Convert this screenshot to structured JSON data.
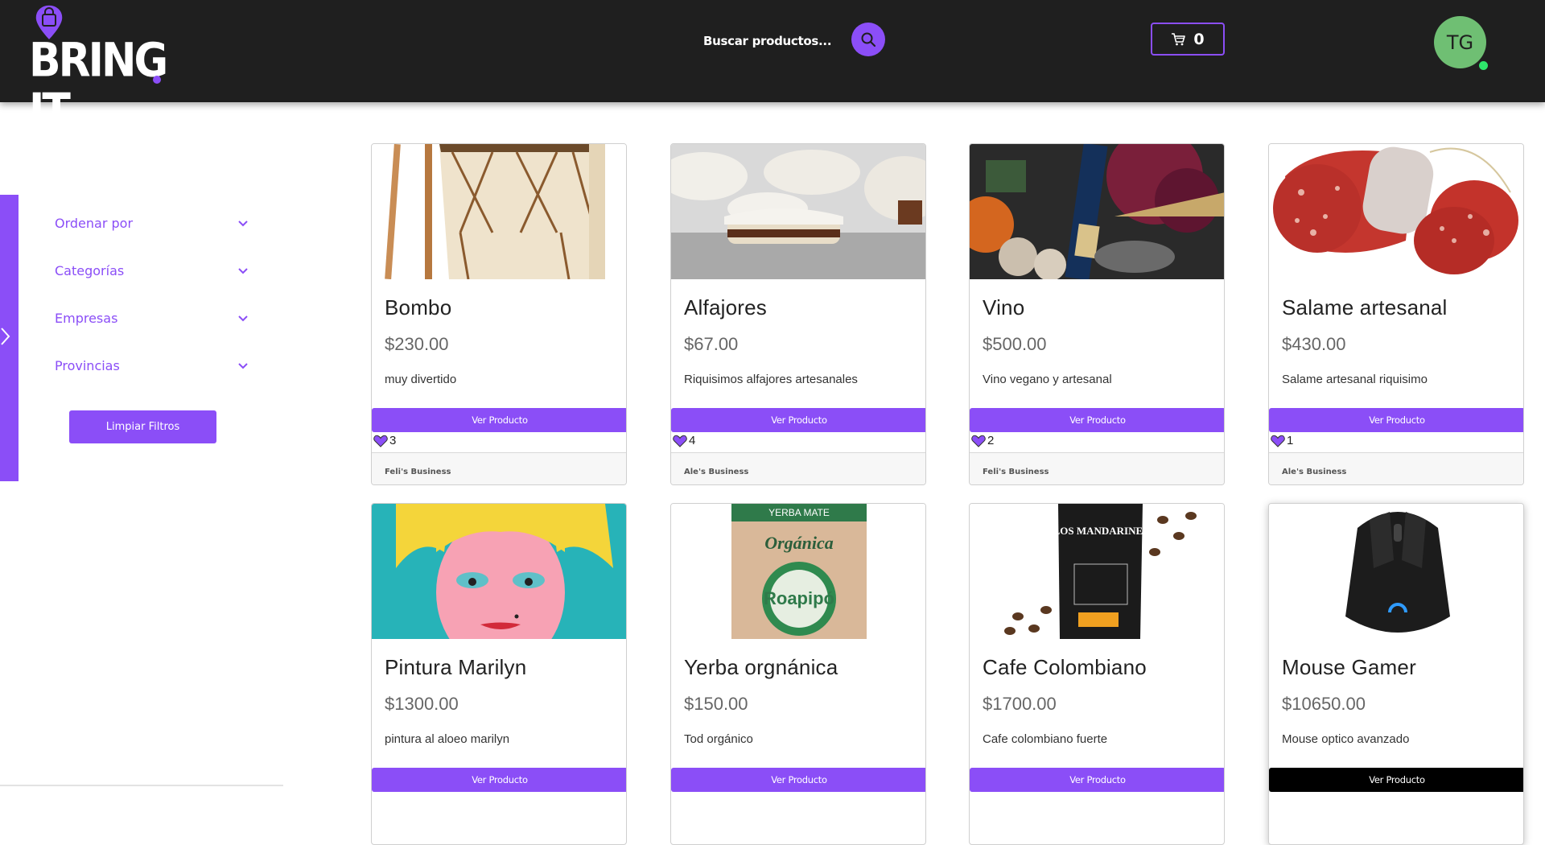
{
  "header": {
    "logo_text": "BRING IT",
    "search": {
      "placeholder": "Buscar productos..."
    },
    "cart": {
      "count": "0"
    },
    "user": {
      "initials": "TG"
    }
  },
  "sidebar": {
    "filters": [
      {
        "label": "Ordenar por"
      },
      {
        "label": "Categorías"
      },
      {
        "label": "Empresas"
      },
      {
        "label": "Provincias"
      }
    ],
    "clear_label": "Limpiar Filtros"
  },
  "view_product_label": "Ver Producto",
  "products": [
    {
      "title": "Bombo",
      "price": "$230.00",
      "description": "muy divertido",
      "likes": "3",
      "business": "Feli's Business"
    },
    {
      "title": "Alfajores",
      "price": "$67.00",
      "description": "Riquisimos alfajores artesanales",
      "likes": "4",
      "business": "Ale's Business"
    },
    {
      "title": "Vino",
      "price": "$500.00",
      "description": "Vino vegano y artesanal",
      "likes": "2",
      "business": "Feli's Business"
    },
    {
      "title": "Salame artesanal",
      "price": "$430.00",
      "description": "Salame artesanal riquisimo",
      "likes": "1",
      "business": "Ale's Business"
    },
    {
      "title": "Pintura Marilyn",
      "price": "$1300.00",
      "description": "pintura al aloeo marilyn"
    },
    {
      "title": "Yerba orgnánica",
      "price": "$150.00",
      "description": "Tod orgánico",
      "image_text": [
        "YERBA MATE",
        "Orgánica",
        "Roapipó"
      ]
    },
    {
      "title": "Cafe Colombiano",
      "price": "$1700.00",
      "description": "Cafe colombiano fuerte",
      "image_text": [
        "LOS MANDARINES"
      ]
    },
    {
      "title": "Mouse Gamer",
      "price": "$10650.00",
      "description": "Mouse optico avanzado"
    }
  ],
  "colors": {
    "accent": "#8b4ef7",
    "header_bg": "#1f1f1f",
    "avatar": "#6fbf73",
    "online": "#2ee66b"
  }
}
